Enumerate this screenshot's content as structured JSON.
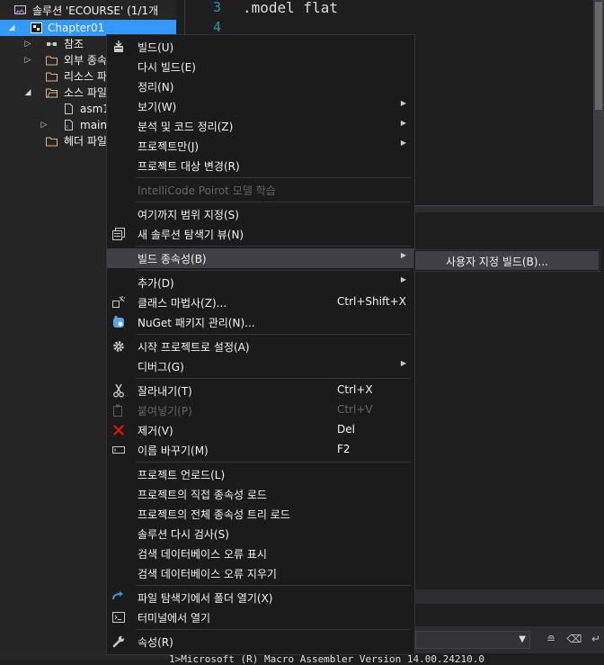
{
  "explorer": {
    "solution_label": "솔루션 'ECOURSE' (1/1개",
    "project_label": "Chapter01",
    "items": [
      {
        "label": "참조"
      },
      {
        "label": "외부 종속"
      },
      {
        "label": "리소스 파"
      },
      {
        "label": "소스 파일"
      },
      {
        "label": "asm1"
      },
      {
        "label": "main."
      },
      {
        "label": "헤더 파일"
      }
    ]
  },
  "editor": {
    "line_numbers": [
      "3",
      "4"
    ],
    "lines": [
      ".model flat"
    ]
  },
  "context_menu": {
    "items": [
      {
        "label": "빌드(U)",
        "icon": "build-icon"
      },
      {
        "label": "다시 빌드(E)"
      },
      {
        "label": "정리(N)"
      },
      {
        "label": "보기(W)",
        "has_submenu": true
      },
      {
        "label": "분석 및 코드 정리(Z)",
        "has_submenu": true
      },
      {
        "label": "프로젝트만(J)",
        "has_submenu": true
      },
      {
        "label": "프로젝트 대상 변경(R)"
      },
      {
        "label": "IntelliCode Poirot 모델 학습",
        "disabled": true
      },
      {
        "label": "여기까지 범위 지정(S)"
      },
      {
        "label": "새 솔루션 탐색기 뷰(N)",
        "icon": "new-view-icon"
      },
      {
        "label": "빌드 종속성(B)",
        "has_submenu": true,
        "highlighted": true
      },
      {
        "label": "추가(D)",
        "has_submenu": true
      },
      {
        "label": "클래스 마법사(Z)...",
        "shortcut": "Ctrl+Shift+X",
        "icon": "class-wizard-icon"
      },
      {
        "label": "NuGet 패키지 관리(N)...",
        "icon": "nuget-icon"
      },
      {
        "label": "시작 프로젝트로 설정(A)",
        "icon": "gear-icon"
      },
      {
        "label": "디버그(G)",
        "has_submenu": true
      },
      {
        "label": "잘라내기(T)",
        "shortcut": "Ctrl+X",
        "icon": "cut-icon"
      },
      {
        "label": "붙여넣기(P)",
        "shortcut": "Ctrl+V",
        "disabled": true,
        "icon": "paste-icon"
      },
      {
        "label": "제거(V)",
        "shortcut": "Del",
        "icon": "remove-icon"
      },
      {
        "label": "이름 바꾸기(M)",
        "shortcut": "F2",
        "icon": "rename-icon"
      },
      {
        "label": "프로젝트 언로드(L)"
      },
      {
        "label": "프로젝트의 직접 종속성 로드"
      },
      {
        "label": "프로젝트의 전체 종속성 트리 로드"
      },
      {
        "label": "솔루션 다시 검사(S)"
      },
      {
        "label": "검색 데이터베이스 오류 표시"
      },
      {
        "label": "검색 데이터베이스 오류 지우기"
      },
      {
        "label": "파일 탐색기에서 폴더 열기(X)",
        "icon": "open-folder-icon"
      },
      {
        "label": "터미널에서 열기",
        "icon": "terminal-icon"
      },
      {
        "label": "속성(R)",
        "icon": "wrench-icon"
      }
    ]
  },
  "submenu": {
    "items": [
      {
        "label": "사용자 지정 빌드(B)..."
      }
    ]
  },
  "output": {
    "text": "1>Microsoft (R) Macro Assembler Version 14.00.24210.0"
  },
  "colors": {
    "selection": "#3399ff",
    "menu_bg": "#1b1b1c",
    "menu_highlight": "#3f3f46",
    "line_number": "#2b91af",
    "remove_icon": "#e51400",
    "nuget_icon": "#5aa4e0"
  }
}
